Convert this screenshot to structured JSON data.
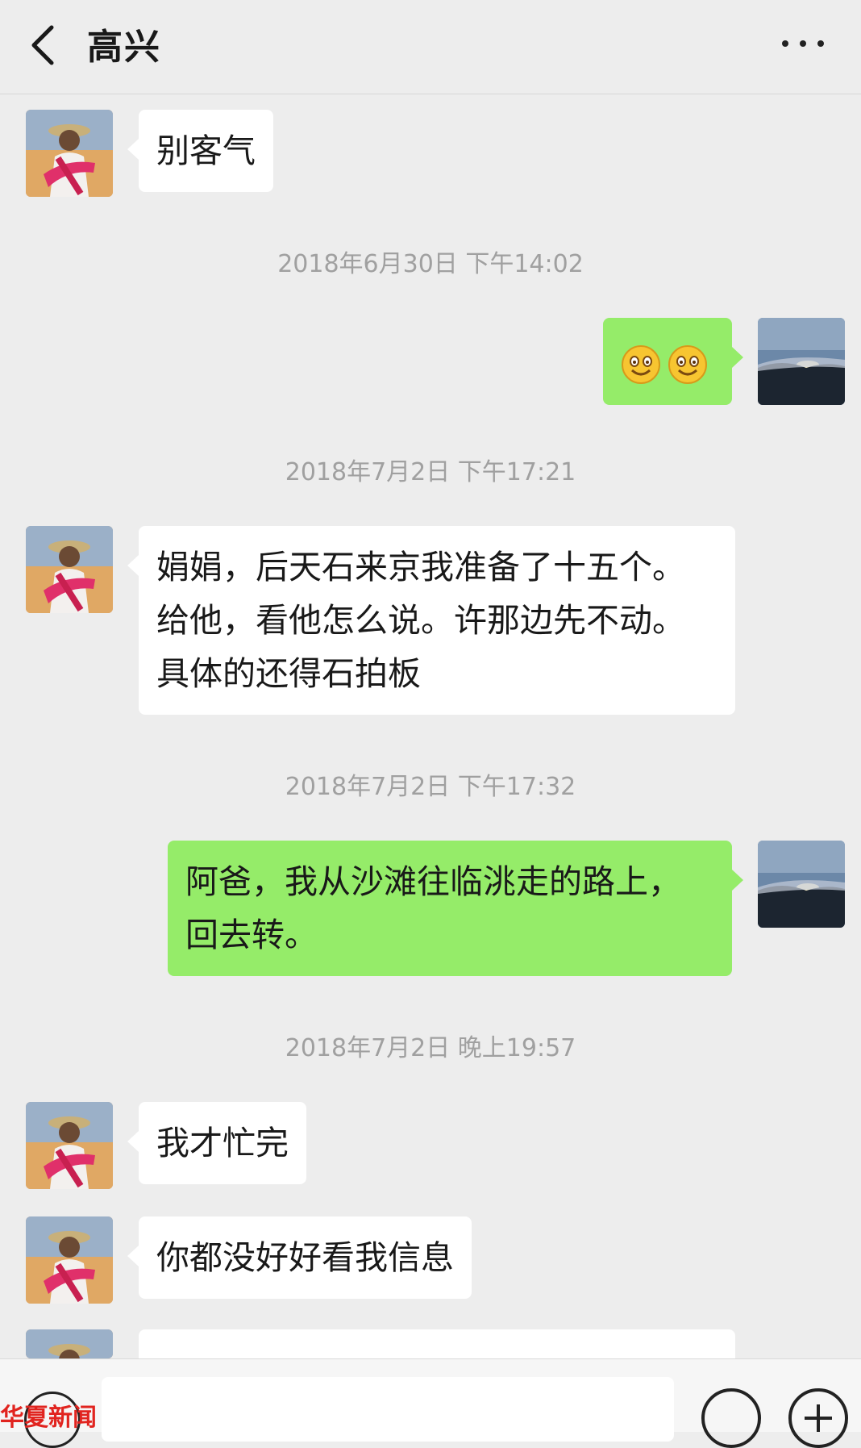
{
  "header": {
    "title": "高兴"
  },
  "colors": {
    "background": "#ededed",
    "incoming_bubble": "#ffffff",
    "outgoing_bubble": "#95ec69",
    "timestamp": "#a0a0a0"
  },
  "messages": [
    {
      "kind": "message",
      "direction": "in",
      "text": "别客气"
    },
    {
      "kind": "timestamp",
      "text": "2018年6月30日 下午14:02"
    },
    {
      "kind": "message",
      "direction": "out",
      "content": "two smile emoji"
    },
    {
      "kind": "timestamp",
      "text": "2018年7月2日 下午17:21"
    },
    {
      "kind": "message",
      "direction": "in",
      "lines": [
        "娟娟，后天石来京我准备了十五个。",
        "给他，看他怎么说。许那边先不动。",
        "具体的还得石拍板"
      ]
    },
    {
      "kind": "timestamp",
      "text": "2018年7月2日 下午17:32"
    },
    {
      "kind": "message",
      "direction": "out",
      "lines": [
        "阿爸，我从沙滩往临洮走的路上，",
        "回去转。"
      ]
    },
    {
      "kind": "timestamp",
      "text": "2018年7月2日 晚上19:57"
    },
    {
      "kind": "message",
      "direction": "in",
      "text": "我才忙完"
    },
    {
      "kind": "message",
      "direction": "in",
      "text": "你都没好好看我信息"
    }
  ],
  "input_bar": {
    "icons": [
      "voice-icon",
      "emoji-icon",
      "plus-icon"
    ]
  },
  "watermark": {
    "text": "华夏新闻"
  }
}
